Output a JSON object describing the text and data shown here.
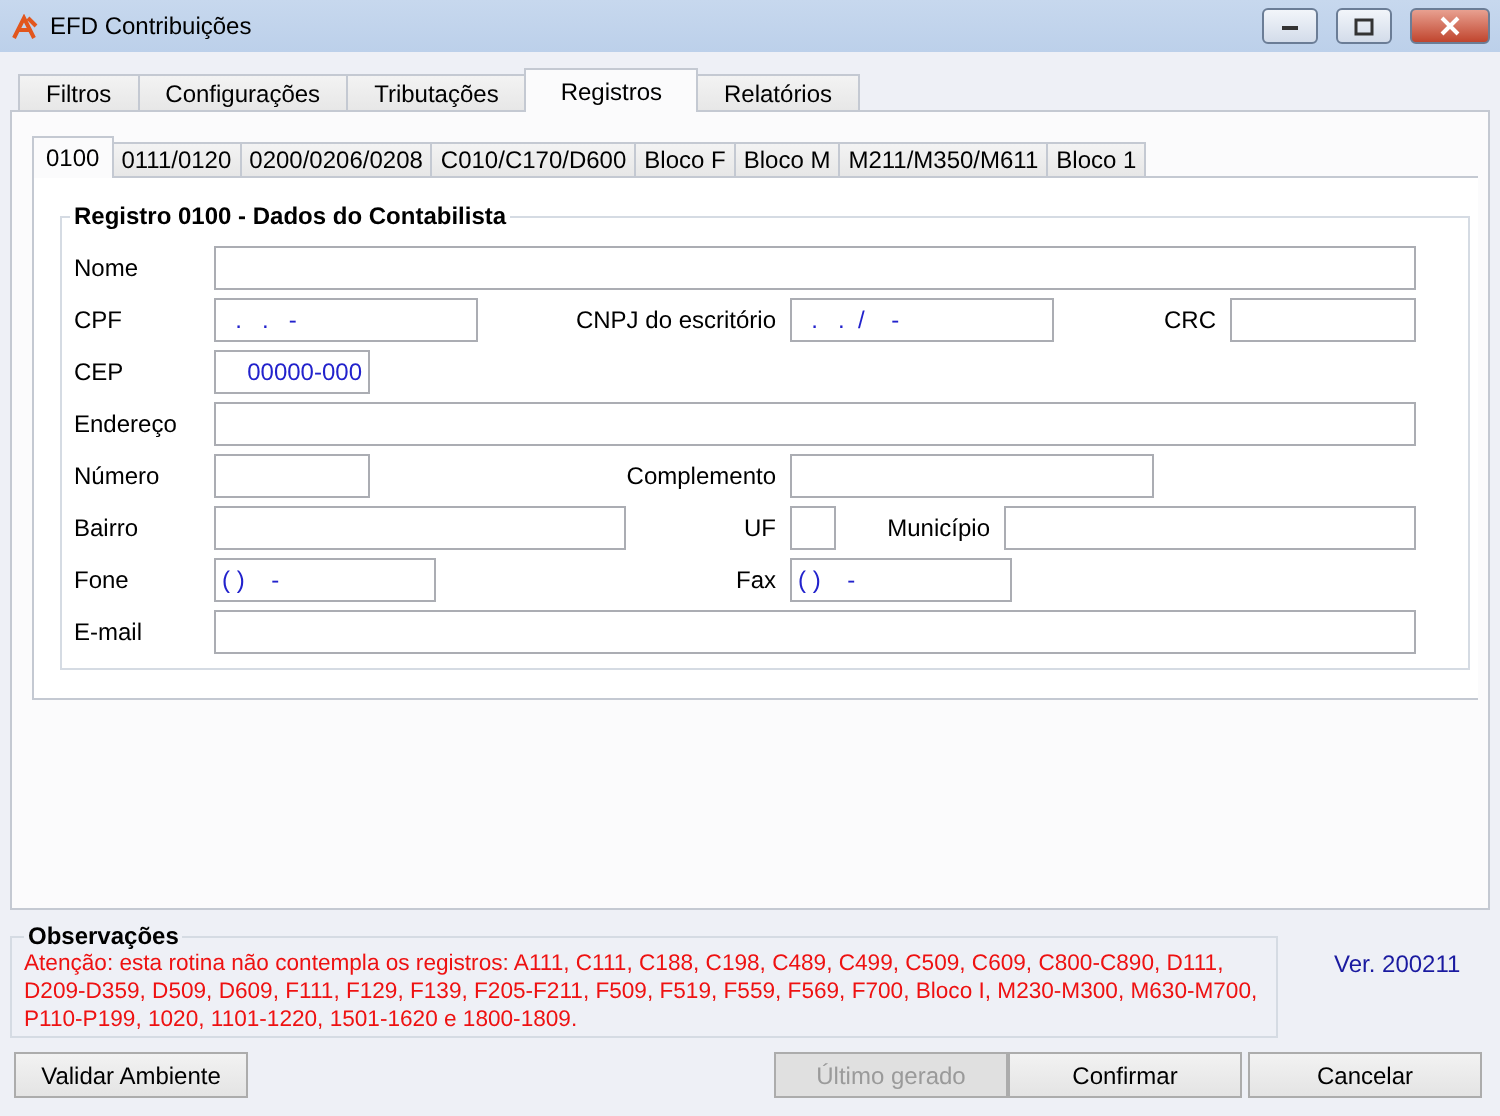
{
  "window": {
    "title": "EFD Contribuições"
  },
  "tabs": [
    {
      "label": "Filtros",
      "selected": false
    },
    {
      "label": "Configurações",
      "selected": false
    },
    {
      "label": "Tributações",
      "selected": false
    },
    {
      "label": "Registros",
      "selected": true
    },
    {
      "label": "Relatórios",
      "selected": false
    }
  ],
  "subtabs": [
    {
      "label": "0100",
      "selected": true
    },
    {
      "label": "0111/0120",
      "selected": false
    },
    {
      "label": "0200/0206/0208",
      "selected": false
    },
    {
      "label": "C010/C170/D600",
      "selected": false
    },
    {
      "label": "Bloco F",
      "selected": false
    },
    {
      "label": "Bloco M",
      "selected": false
    },
    {
      "label": "M211/M350/M611",
      "selected": false
    },
    {
      "label": "Bloco 1",
      "selected": false
    }
  ],
  "group": {
    "title": "Registro 0100 - Dados do Contabilista",
    "rows": [
      [
        {
          "label": "Nome"
        }
      ],
      [
        {
          "label": "CPF",
          "value": "  .   .   -"
        },
        {
          "label": "CNPJ do escritório",
          "value": "  .   .  /    -"
        },
        {
          "label": "CRC"
        }
      ],
      [
        {
          "label": "CEP",
          "value": "00000-000"
        }
      ],
      [
        {
          "label": "Endereço"
        }
      ],
      [
        {
          "label": "Número"
        },
        {
          "label": "Complemento"
        }
      ],
      [
        {
          "label": "Bairro"
        },
        {
          "label": "UF"
        },
        {
          "label": "Município"
        }
      ],
      [
        {
          "label": "Fone",
          "value": "( )    -"
        },
        {
          "label": "Fax",
          "value": "( )    -"
        }
      ],
      [
        {
          "label": "E-mail"
        }
      ]
    ]
  },
  "observations": {
    "title": "Observações",
    "text": "Atenção: esta rotina não contempla os registros: A111, C111, C188, C198, C489, C499, C509, C609, C800-C890, D111, D209-D359, D509, D609, F111, F129, F139, F205-F211, F509, F519, F559, F569, F700, Bloco I, M230-M300, M630-M700, P110-P199, 1020, 1101-1220, 1501-1620 e 1800-1809."
  },
  "version": "Ver. 200211",
  "buttons": [
    {
      "label": "Validar Ambiente",
      "disabled": false
    },
    {
      "label": "Último gerado",
      "disabled": true
    },
    {
      "label": "Confirmar",
      "disabled": false
    },
    {
      "label": "Cancelar",
      "disabled": false
    }
  ]
}
